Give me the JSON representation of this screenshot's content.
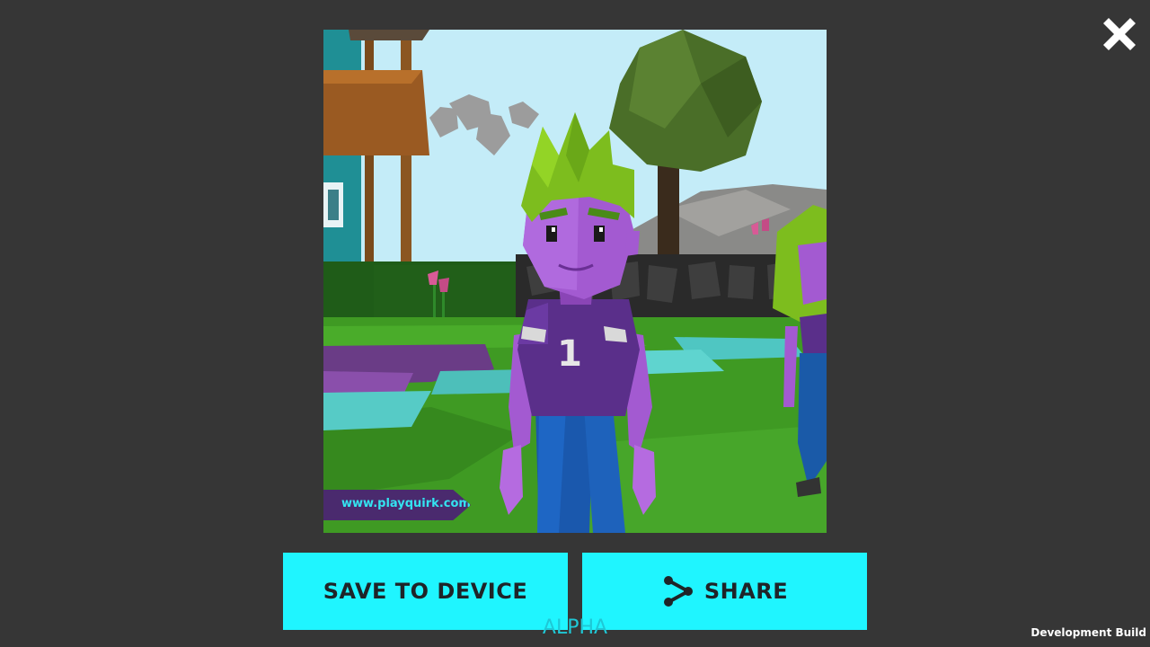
{
  "close": {
    "icon": "close-icon"
  },
  "photo": {
    "description_icon": "photo-preview",
    "watermark": "www.playquirk.com",
    "jersey_number": "1"
  },
  "actions": {
    "save_label": "SAVE TO DEVICE",
    "share_label": "SHARE",
    "share_icon": "share-icon"
  },
  "footer": {
    "alpha_label": "ALPHA",
    "build_label": "Development Build"
  },
  "colors": {
    "background": "#363636",
    "button": "#1ff5ff",
    "button_text": "#1f2428",
    "alpha_text": "#1fc8d6"
  }
}
